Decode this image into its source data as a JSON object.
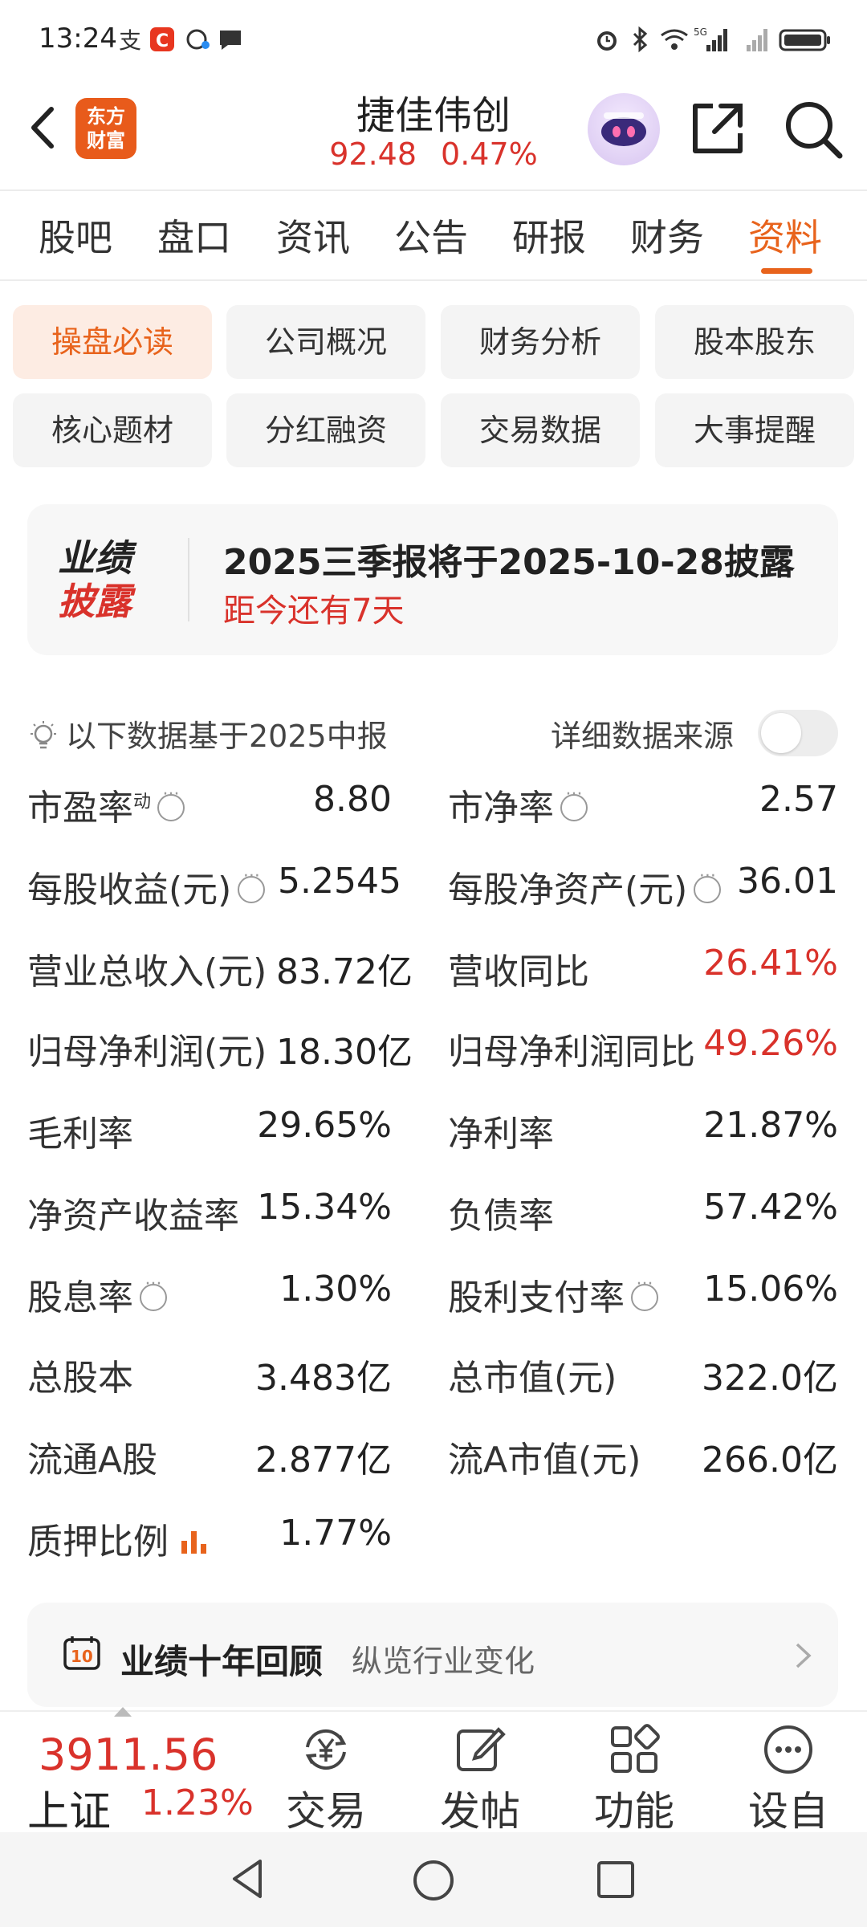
{
  "status_bar": {
    "time": "13:24"
  },
  "header": {
    "stock_name": "捷佳伟创",
    "price": "92.48",
    "change_pct": "0.47%",
    "logo_line1": "东方",
    "logo_line2": "财富"
  },
  "tabs": [
    {
      "label": "股吧"
    },
    {
      "label": "盘口"
    },
    {
      "label": "资讯"
    },
    {
      "label": "公告"
    },
    {
      "label": "研报"
    },
    {
      "label": "财务"
    },
    {
      "label": "资料",
      "active": true
    }
  ],
  "chips": [
    {
      "label": "操盘必读",
      "active": true
    },
    {
      "label": "公司概况"
    },
    {
      "label": "财务分析"
    },
    {
      "label": "股本股东"
    },
    {
      "label": "核心题材"
    },
    {
      "label": "分红融资"
    },
    {
      "label": "交易数据"
    },
    {
      "label": "大事提醒"
    }
  ],
  "earnings": {
    "badge_line1": "业绩",
    "badge_line2": "披露",
    "title": "2025三季报将于2025-10-28披露",
    "subtitle": "距今还有7天"
  },
  "notice": {
    "text": "以下数据基于2025中报",
    "source_label": "详细数据来源",
    "source_toggle_on": false
  },
  "metrics": {
    "pe_label": "市盈率",
    "pe_sup": "动",
    "pe_value": "8.80",
    "pb_label": "市净率",
    "pb_value": "2.57",
    "eps_label": "每股收益(元)",
    "eps_value": "5.2545",
    "bvps_label": "每股净资产(元)",
    "bvps_value": "36.01",
    "revenue_label": "营业总收入(元)",
    "revenue_value": "83.72亿",
    "revenue_yoy_label": "营收同比",
    "revenue_yoy_value": "26.41%",
    "netprofit_label": "归母净利润(元)",
    "netprofit_value": "18.30亿",
    "netprofit_yoy_label": "归母净利润同比",
    "netprofit_yoy_value": "49.26%",
    "gross_margin_label": "毛利率",
    "gross_margin_value": "29.65%",
    "net_margin_label": "净利率",
    "net_margin_value": "21.87%",
    "roe_label": "净资产收益率",
    "roe_value": "15.34%",
    "debt_ratio_label": "负债率",
    "debt_ratio_value": "57.42%",
    "div_yield_label": "股息率",
    "div_yield_value": "1.30%",
    "payout_label": "股利支付率",
    "payout_value": "15.06%",
    "total_shares_label": "总股本",
    "total_shares_value": "3.483亿",
    "mkt_cap_label": "总市值(元)",
    "mkt_cap_value": "322.0亿",
    "float_shares_label": "流通A股",
    "float_shares_value": "2.877亿",
    "float_cap_label": "流A市值(元)",
    "float_cap_value": "266.0亿",
    "pledge_label": "质押比例",
    "pledge_value": "1.77%"
  },
  "review": {
    "icon_text": "10",
    "title": "业绩十年回顾",
    "subtitle": "纵览行业变化"
  },
  "bottom_bar": {
    "index_value": "3911.56",
    "index_name": "上证",
    "index_pct": "1.23%",
    "nav": [
      {
        "label": "交易",
        "icon": "yen-exchange-icon"
      },
      {
        "label": "发帖",
        "icon": "edit-icon"
      },
      {
        "label": "功能",
        "icon": "grid-icon"
      },
      {
        "label": "设自选",
        "icon": "more-icon"
      }
    ]
  },
  "colors": {
    "accent": "#e8631c",
    "up_red": "#d9322b",
    "chip_bg": "#f4f4f4"
  }
}
